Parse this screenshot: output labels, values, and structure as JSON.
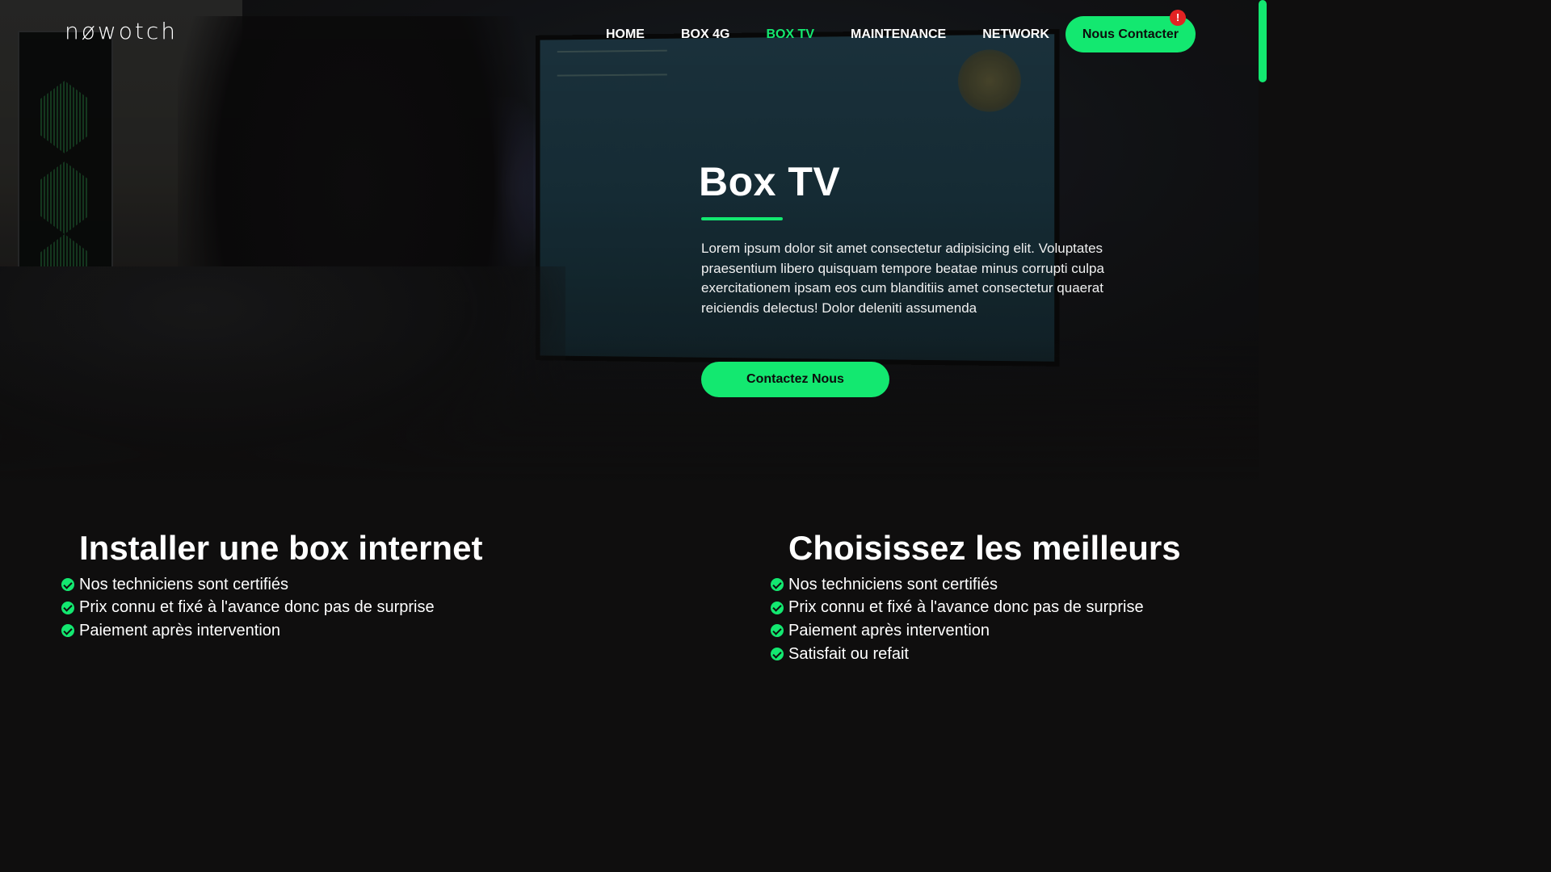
{
  "brand": {
    "logo_text": "nøwotch",
    "accent_color": "#13e870",
    "alert_color": "#e22323"
  },
  "nav": {
    "items": [
      {
        "label": "HOME",
        "active": false
      },
      {
        "label": "BOX 4G",
        "active": false
      },
      {
        "label": "BOX TV",
        "active": true
      },
      {
        "label": "MAINTENANCE",
        "active": false
      },
      {
        "label": "NETWORK",
        "active": false
      }
    ],
    "cta_label": "Nous Contacter",
    "cta_badge": "!"
  },
  "hero": {
    "title": "Box TV",
    "text": "Lorem ipsum dolor sit amet consectetur adipisicing elit. Voluptates praesentium libero quisquam tempore beatae minus corrupti culpa exercitationem ipsam eos cum blanditiis amet consectetur quaerat reiciendis delectus! Dolor deleniti assumenda",
    "button_label": "Contactez Nous"
  },
  "features": {
    "left": {
      "title": "Installer une box internet",
      "items": [
        "Nos techniciens sont certifiés",
        "Prix connu et fixé à l'avance donc pas de surprise",
        "Paiement après intervention"
      ]
    },
    "right": {
      "title": "Choisissez les meilleurs",
      "items": [
        "Nos techniciens sont certifiés",
        "Prix connu et fixé à l'avance donc pas de surprise",
        "Paiement après intervention",
        "Satisfait ou refait"
      ]
    }
  }
}
